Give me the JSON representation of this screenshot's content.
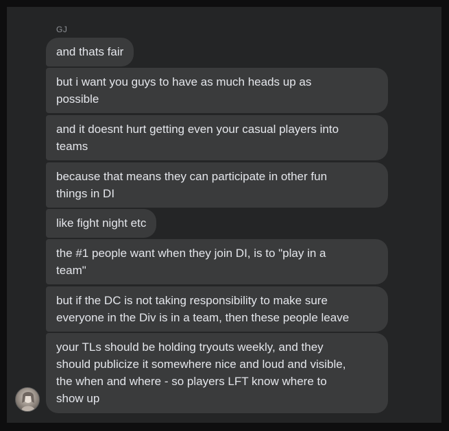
{
  "conversation": {
    "sender_name": "GJ",
    "messages": [
      {
        "text": "and thats fair"
      },
      {
        "text": "but i want you guys to have as much heads up as\npossible"
      },
      {
        "text": "and it doesnt hurt getting even your casual players into\nteams"
      },
      {
        "text": "because that means they can participate in other fun\nthings in DI"
      },
      {
        "text": "like fight night etc"
      },
      {
        "text": "the #1 people want when they join DI, is to \"play in a\nteam\""
      },
      {
        "text": "but if the DC is not taking responsibility to make sure\neveryone in the Div is in a team, then these people leave"
      },
      {
        "text": "your TLs should be holding tryouts weekly, and they\nshould publicize it somewhere nice and loud and visible,\nthe when and where - so players LFT know where to\nshow up"
      }
    ]
  },
  "colors": {
    "background": "#0e0e0f",
    "panel": "#242526",
    "bubble": "#3a3b3c",
    "text": "#e4e6eb",
    "sender": "#8f9297"
  },
  "icons": {
    "avatar": "user-avatar-photo"
  }
}
